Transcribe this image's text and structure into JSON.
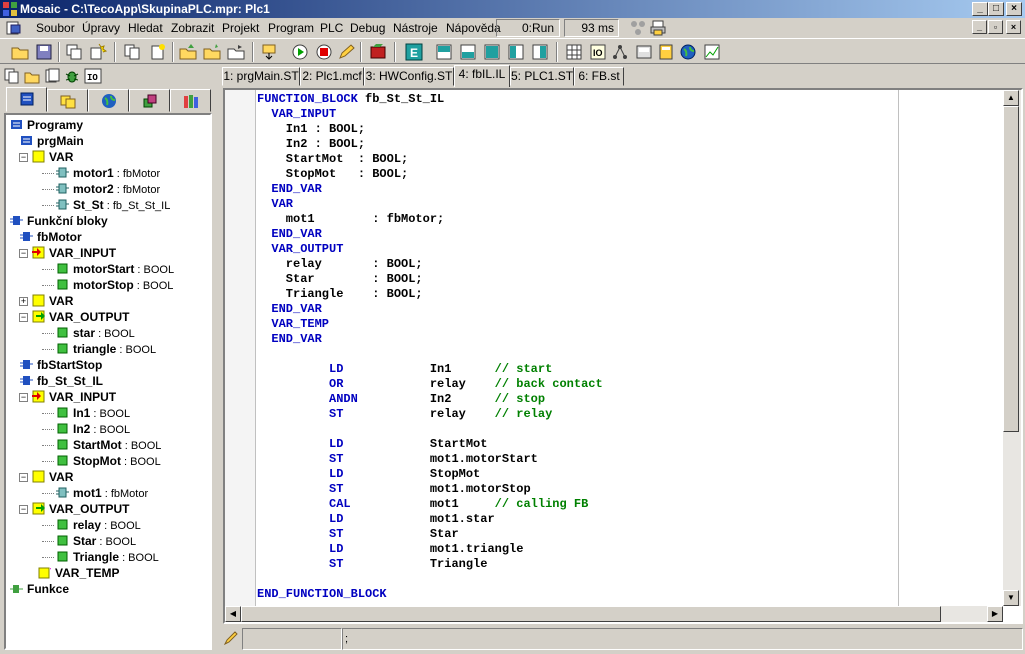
{
  "window": {
    "title": "Mosaic - C:\\TecoApp\\SkupinaPLC.mpr: Plc1",
    "app_icon": "mosaic-logo-icon",
    "buttons": [
      "minimize-icon",
      "maximize-icon",
      "close-icon"
    ]
  },
  "menu": {
    "items": [
      "Soubor",
      "Úpravy",
      "Hledat",
      "Zobrazit",
      "Projekt",
      "Program",
      "PLC",
      "Debug",
      "Nástroje",
      "Nápověda"
    ],
    "run_status": "0:Run",
    "cycle_time": "93 ms"
  },
  "toolbar": {
    "icons": [
      "open-folder-icon",
      "save-icon",
      "copy-windows-icon",
      "new-project-icon",
      "copy-icon",
      "new-file-icon",
      "folder-up-icon",
      "folder-add-icon",
      "folder-export-icon",
      "compile-icon",
      "run-icon",
      "stop-icon",
      "debug-pencil-icon",
      "build-icon",
      "e-mark-icon",
      "layout-1-icon",
      "layout-2-icon",
      "layout-3-icon",
      "layout-4-icon",
      "layout-5-icon",
      "grid-icon",
      "io-icon",
      "network-icon",
      "panel-icon",
      "calculator-icon",
      "globe-icon",
      "graph-icon"
    ]
  },
  "left_pane": {
    "toolbar_icons": [
      "pages-icon",
      "folder-page-icon",
      "stack-icon",
      "bug-icon",
      "i-o-icon"
    ],
    "tabs": [
      "programs-tab-icon",
      "files-tab-icon",
      "globe-tab-icon",
      "objects-tab-icon",
      "library-tab-icon"
    ],
    "tree": [
      {
        "label": "Programy",
        "bold": true,
        "type": ""
      },
      {
        "label": "prgMain",
        "bold": true,
        "type": ""
      },
      {
        "label": "VAR",
        "bold": true,
        "type": ""
      },
      {
        "label": "motor1",
        "bold": true,
        "type": " : fbMotor"
      },
      {
        "label": "motor2",
        "bold": true,
        "type": " : fbMotor"
      },
      {
        "label": "St_St",
        "bold": true,
        "type": " : fb_St_St_IL"
      },
      {
        "label": "Funkční bloky",
        "bold": true,
        "type": ""
      },
      {
        "label": "fbMotor",
        "bold": true,
        "type": ""
      },
      {
        "label": "VAR_INPUT",
        "bold": true,
        "type": ""
      },
      {
        "label": "motorStart",
        "bold": true,
        "type": " : BOOL"
      },
      {
        "label": "motorStop",
        "bold": true,
        "type": " : BOOL"
      },
      {
        "label": "VAR",
        "bold": true,
        "type": ""
      },
      {
        "label": "VAR_OUTPUT",
        "bold": true,
        "type": ""
      },
      {
        "label": "star",
        "bold": true,
        "type": " : BOOL"
      },
      {
        "label": "triangle",
        "bold": true,
        "type": " : BOOL"
      },
      {
        "label": "fbStartStop",
        "bold": true,
        "type": ""
      },
      {
        "label": "fb_St_St_IL",
        "bold": true,
        "type": ""
      },
      {
        "label": "VAR_INPUT",
        "bold": true,
        "type": ""
      },
      {
        "label": "In1",
        "bold": true,
        "type": " : BOOL"
      },
      {
        "label": "In2",
        "bold": true,
        "type": " : BOOL"
      },
      {
        "label": "StartMot",
        "bold": true,
        "type": " : BOOL"
      },
      {
        "label": "StopMot",
        "bold": true,
        "type": " : BOOL"
      },
      {
        "label": "VAR",
        "bold": true,
        "type": ""
      },
      {
        "label": "mot1",
        "bold": true,
        "type": " : fbMotor"
      },
      {
        "label": "VAR_OUTPUT",
        "bold": true,
        "type": ""
      },
      {
        "label": "relay",
        "bold": true,
        "type": " : BOOL"
      },
      {
        "label": "Star",
        "bold": true,
        "type": " : BOOL"
      },
      {
        "label": "Triangle",
        "bold": true,
        "type": " : BOOL"
      },
      {
        "label": "VAR_TEMP",
        "bold": true,
        "type": ""
      },
      {
        "label": "Funkce",
        "bold": true,
        "type": ""
      }
    ]
  },
  "doc_tabs": [
    "1: prgMain.ST",
    "2: Plc1.mcf",
    "3: HWConfig.ST",
    "4: fbIL.IL",
    "5: PLC1.ST",
    "6: FB.st"
  ],
  "active_tab": "4: fbIL.IL",
  "code_lines": [
    [
      {
        "t": "FUNCTION_BLOCK",
        "c": "kw"
      },
      {
        "t": " fb_St_St_IL",
        "c": ""
      }
    ],
    [
      {
        "t": "  VAR_INPUT",
        "c": "kw"
      }
    ],
    [
      {
        "t": "    In1 : BOOL;",
        "c": ""
      }
    ],
    [
      {
        "t": "    In2 : BOOL;",
        "c": ""
      }
    ],
    [
      {
        "t": "    StartMot  : BOOL;",
        "c": ""
      }
    ],
    [
      {
        "t": "    StopMot   : BOOL;",
        "c": ""
      }
    ],
    [
      {
        "t": "  END_VAR",
        "c": "kw"
      }
    ],
    [
      {
        "t": "  VAR",
        "c": "kw"
      }
    ],
    [
      {
        "t": "    mot1        : fbMotor;",
        "c": ""
      }
    ],
    [
      {
        "t": "  END_VAR",
        "c": "kw"
      }
    ],
    [
      {
        "t": "  VAR_OUTPUT",
        "c": "kw"
      }
    ],
    [
      {
        "t": "    relay       : BOOL;",
        "c": ""
      }
    ],
    [
      {
        "t": "    Star        : BOOL;",
        "c": ""
      }
    ],
    [
      {
        "t": "    Triangle    : BOOL;",
        "c": ""
      }
    ],
    [
      {
        "t": "  END_VAR",
        "c": "kw"
      }
    ],
    [
      {
        "t": "  VAR_TEMP",
        "c": "kw"
      }
    ],
    [
      {
        "t": "  END_VAR",
        "c": "kw"
      }
    ],
    [
      {
        "t": "",
        "c": ""
      }
    ],
    [
      {
        "t": "          LD",
        "c": "kw"
      },
      {
        "t": "            In1      ",
        "c": ""
      },
      {
        "t": "// start",
        "c": "cm"
      }
    ],
    [
      {
        "t": "          OR",
        "c": "kw"
      },
      {
        "t": "            relay    ",
        "c": ""
      },
      {
        "t": "// back contact",
        "c": "cm"
      }
    ],
    [
      {
        "t": "          ANDN",
        "c": "kw"
      },
      {
        "t": "          In2      ",
        "c": ""
      },
      {
        "t": "// stop",
        "c": "cm"
      }
    ],
    [
      {
        "t": "          ST",
        "c": "kw"
      },
      {
        "t": "            relay    ",
        "c": ""
      },
      {
        "t": "// relay",
        "c": "cm"
      }
    ],
    [
      {
        "t": "",
        "c": ""
      }
    ],
    [
      {
        "t": "          LD",
        "c": "kw"
      },
      {
        "t": "            StartMot",
        "c": ""
      }
    ],
    [
      {
        "t": "          ST",
        "c": "kw"
      },
      {
        "t": "            mot1.motorStart",
        "c": ""
      }
    ],
    [
      {
        "t": "          LD",
        "c": "kw"
      },
      {
        "t": "            StopMot",
        "c": ""
      }
    ],
    [
      {
        "t": "          ST",
        "c": "kw"
      },
      {
        "t": "            mot1.motorStop",
        "c": ""
      }
    ],
    [
      {
        "t": "          CAL",
        "c": "kw"
      },
      {
        "t": "           mot1     ",
        "c": ""
      },
      {
        "t": "// calling FB",
        "c": "cm"
      }
    ],
    [
      {
        "t": "          LD",
        "c": "kw"
      },
      {
        "t": "            mot1.star",
        "c": ""
      }
    ],
    [
      {
        "t": "          ST",
        "c": "kw"
      },
      {
        "t": "            Star",
        "c": ""
      }
    ],
    [
      {
        "t": "          LD",
        "c": "kw"
      },
      {
        "t": "            mot1.triangle",
        "c": ""
      }
    ],
    [
      {
        "t": "          ST",
        "c": "kw"
      },
      {
        "t": "            Triangle",
        "c": ""
      }
    ],
    [
      {
        "t": "",
        "c": ""
      }
    ],
    [
      {
        "t": "END_FUNCTION_BLOCK",
        "c": "kw"
      }
    ]
  ],
  "statusbar": {
    "icon": "pencil-icon",
    "text": ";"
  }
}
